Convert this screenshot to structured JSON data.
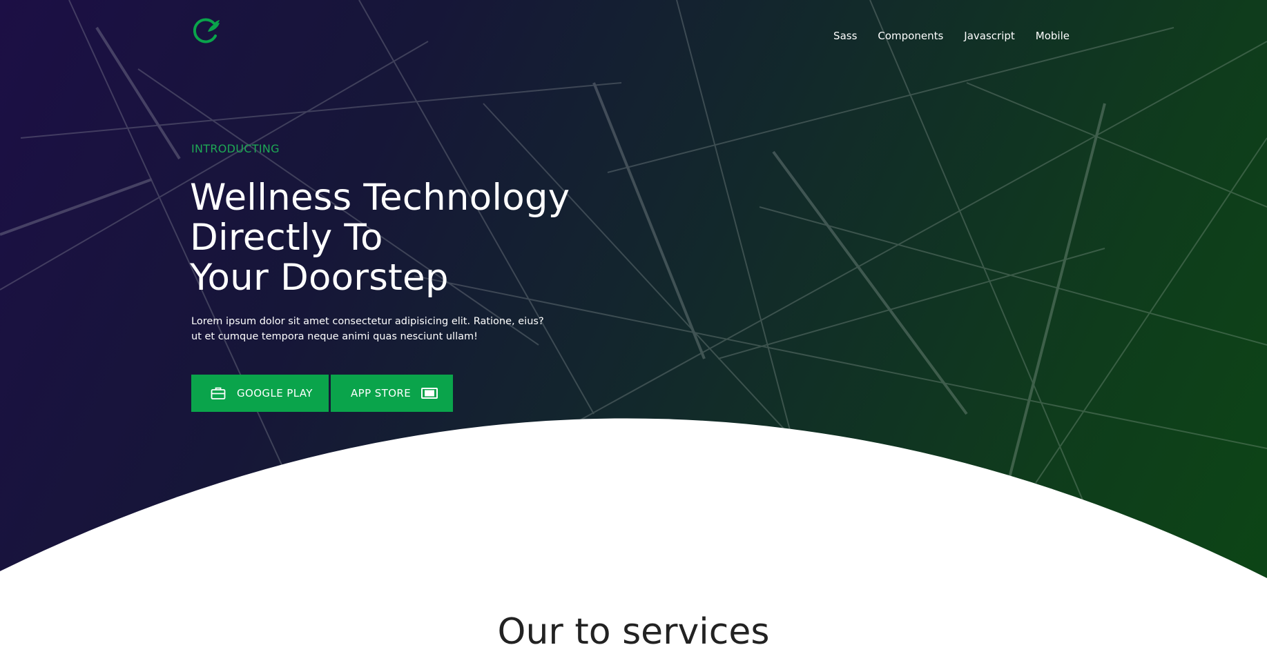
{
  "nav": {
    "links": [
      "Sass",
      "Components",
      "Javascript",
      "Mobile"
    ]
  },
  "hero": {
    "eyebrow": "INTRODUCTING",
    "headline_lines": [
      "Wellness Technology",
      "Directly To",
      "Your Doorstep"
    ],
    "lead_lines": [
      "Lorem ipsum dolor sit amet consectetur adipisicing elit. Ratione, eius?",
      "ut et cumque tempora neque animi quas nesciunt ullam!"
    ],
    "buttons": {
      "google_play": "GOOGLE PLAY",
      "app_store": "APP STORE"
    }
  },
  "services": {
    "title": "Our to services"
  },
  "icons": {
    "logo": "leaf-ring-logo",
    "google_play": "briefcase-icon",
    "app_store": "tablet-icon"
  },
  "colors": {
    "accent": "#0aa44b",
    "eyebrow": "#1ea855",
    "gradient_start": "#1c0f45",
    "gradient_end": "#0c4615",
    "title_text": "#222222"
  }
}
